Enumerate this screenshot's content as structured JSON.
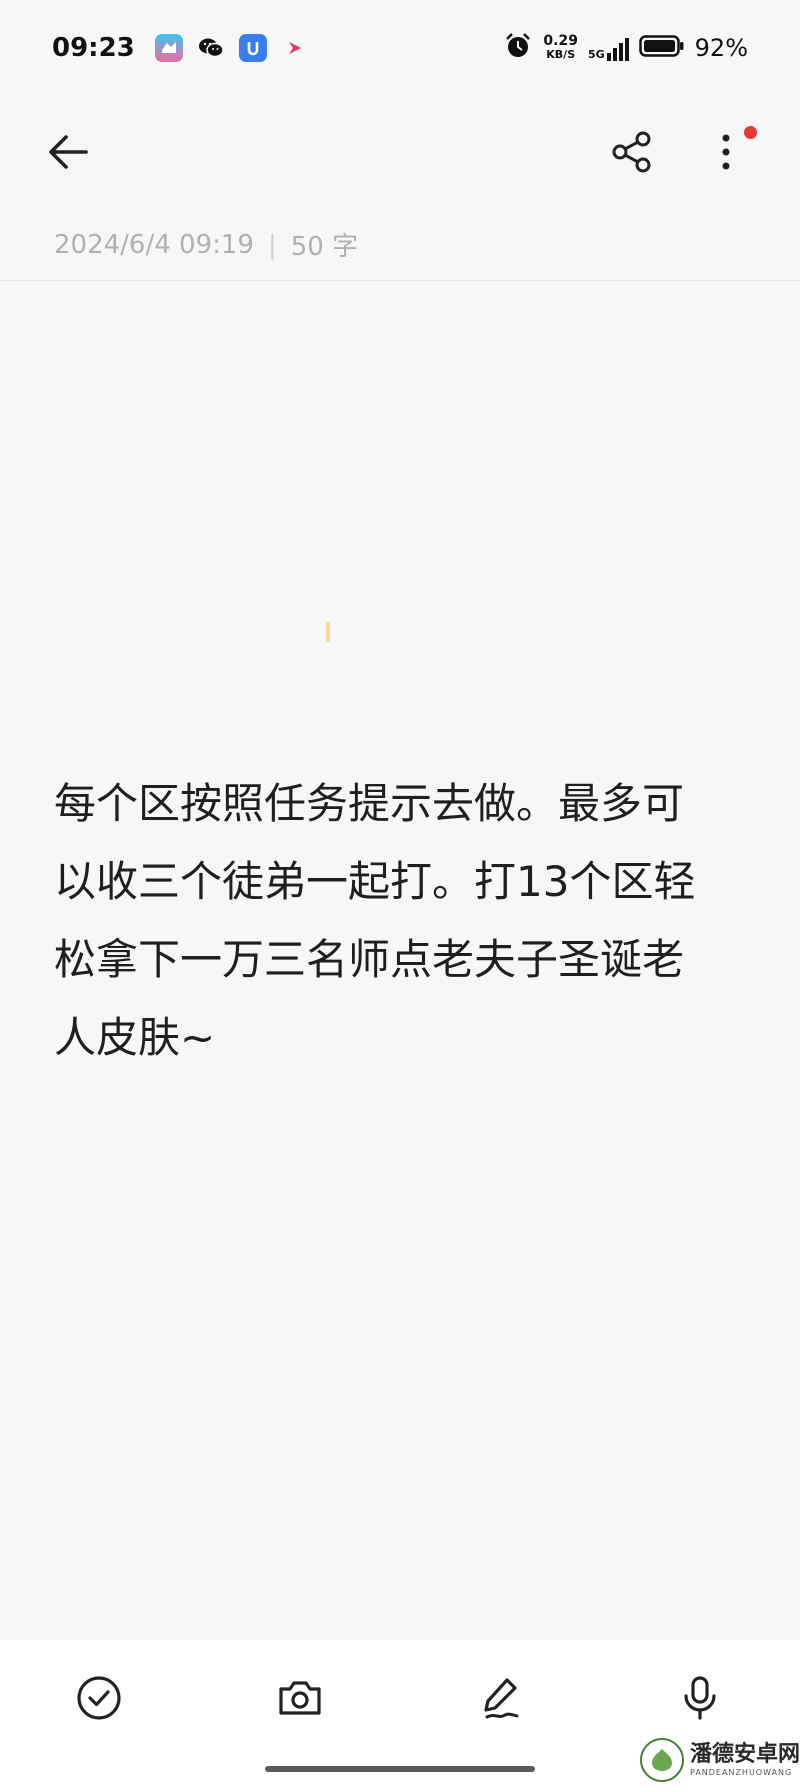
{
  "status_bar": {
    "time": "09:23",
    "net_speed_value": "0.29",
    "net_speed_unit": "KB/S",
    "network_type": "5G",
    "battery_percent": "92%",
    "icons": [
      "alarm-icon",
      "signal-icon",
      "battery-icon"
    ],
    "app_icons": [
      "shopping-app-icon",
      "wechat-icon",
      "blue-app-icon",
      "pink-arrow-app-icon"
    ]
  },
  "toolbar": {
    "back_icon": "arrow-left-icon",
    "share_icon": "share-icon",
    "more_icon": "more-vertical-icon",
    "notification_dot_color": "#e53935"
  },
  "note": {
    "timestamp": "2024/6/4 09:19",
    "separator": "|",
    "word_count": "50 字",
    "content": "每个区按照任务提示去做。最多可\n以收三个徒弟一起打。打13个区轻\n松拿下一万三名师点老夫子圣诞老\n人皮肤~"
  },
  "bottom_bar": {
    "buttons": [
      "checklist-icon",
      "camera-icon",
      "pen-icon",
      "microphone-icon"
    ]
  },
  "watermark": {
    "title": "潘德安卓网",
    "subtitle": "PANDEANZHUOWANG"
  }
}
